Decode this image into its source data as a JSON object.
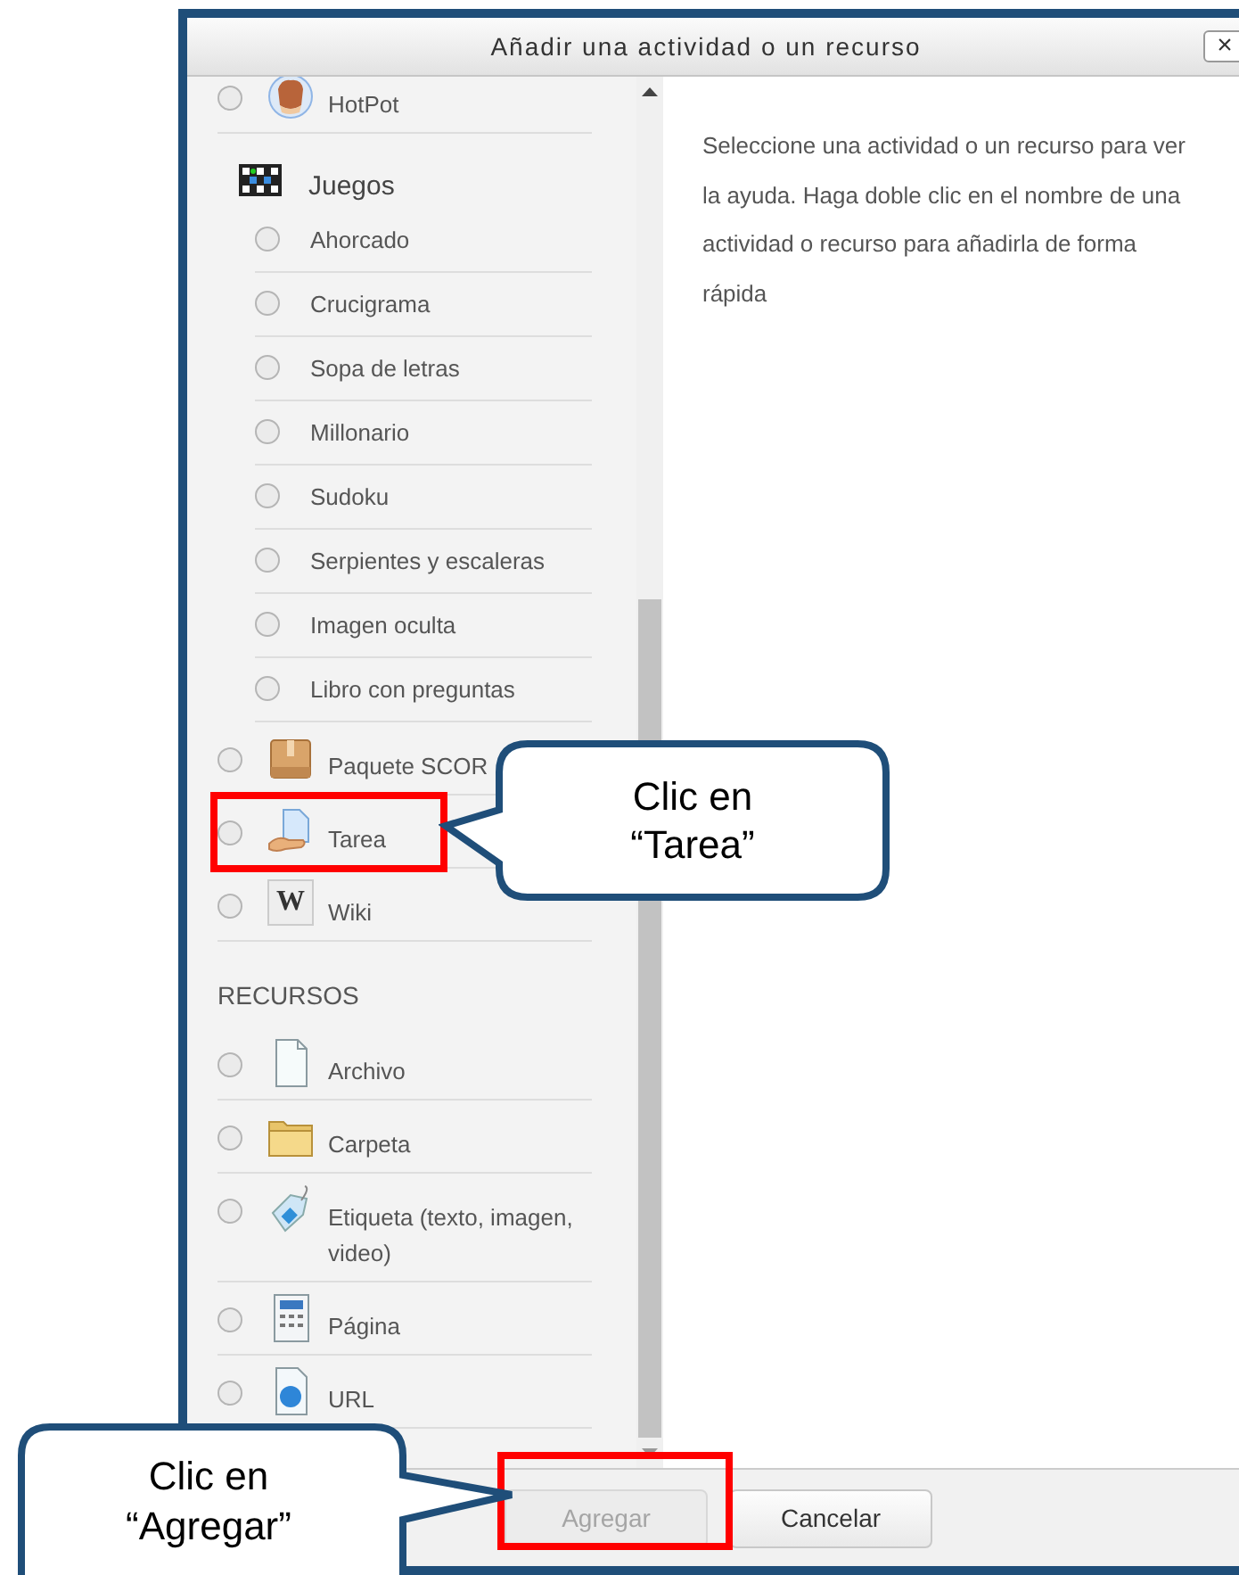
{
  "dialog": {
    "title": "Añadir una actividad o un recurso",
    "close": "×"
  },
  "list": [
    {
      "kind": "item",
      "label": "HotPot",
      "selected": false
    },
    {
      "kind": "group",
      "label": "Juegos",
      "children": [
        {
          "label": "Ahorcado",
          "selected": false
        },
        {
          "label": "Crucigrama",
          "selected": false
        },
        {
          "label": "Sopa de letras",
          "selected": false
        },
        {
          "label": "Millonario",
          "selected": false
        },
        {
          "label": "Sudoku",
          "selected": false
        },
        {
          "label": "Serpientes y escaleras",
          "selected": false
        },
        {
          "label": "Imagen oculta",
          "selected": false
        },
        {
          "label": "Libro con preguntas",
          "selected": false
        }
      ]
    },
    {
      "kind": "item",
      "label": "Paquete SCOR",
      "selected": false
    },
    {
      "kind": "item",
      "label": "Tarea",
      "selected": false
    },
    {
      "kind": "item",
      "label": "Wiki",
      "icon_text": "W",
      "selected": false
    },
    {
      "kind": "section",
      "label": "RECURSOS"
    },
    {
      "kind": "item",
      "label": "Archivo",
      "selected": false
    },
    {
      "kind": "item",
      "label": "Carpeta",
      "selected": false
    },
    {
      "kind": "item",
      "label": "Etiqueta (texto, imagen, video)",
      "selected": false
    },
    {
      "kind": "item",
      "label": "Página",
      "selected": false
    },
    {
      "kind": "item",
      "label": "URL",
      "selected": false
    }
  ],
  "help": "Seleccione una actividad o un recurso para ver la ayuda. Haga doble clic en el nombre de una actividad o recurso para añadirla de forma rápida",
  "buttons": [
    {
      "label": "Agregar",
      "disabled": true
    },
    {
      "label": "Cancelar",
      "disabled": false
    }
  ],
  "callouts": [
    {
      "text": "Clic en “Tarea”"
    },
    {
      "text": "Clic en “Agregar”"
    }
  ]
}
